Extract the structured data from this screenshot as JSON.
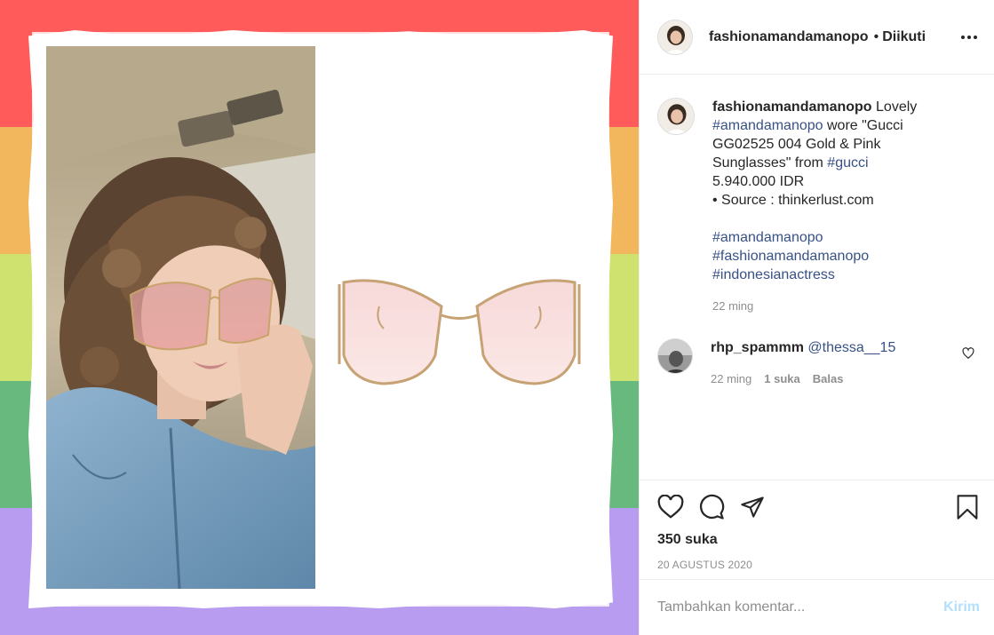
{
  "colors": {
    "stripes": [
      "#ff5b5b",
      "#f2b65c",
      "#cfe16e",
      "#67b97e",
      "#b79cf0"
    ],
    "link": "#385185",
    "secondary_text": "#8e8e8e",
    "post_button": "#b2dffc"
  },
  "header": {
    "username": "fashionamandamanopo",
    "separator": "•",
    "follow_label": "Diikuti",
    "more_icon": "more-options-icon"
  },
  "caption": {
    "username": "fashionamandamanopo",
    "text_1": " Lovely ",
    "hashtag_1": "#amandamanopo",
    "text_2": " wore \"Gucci GG02525 004 Gold & Pink Sunglasses\" from ",
    "hashtag_2": "#gucci",
    "price": "5.940.000 IDR",
    "source": "• Source : thinkerlust.com",
    "hashtags": [
      "#amandamanopo",
      "#fashionamandamanopo",
      "#indonesianactress"
    ],
    "time": "22 ming"
  },
  "comment": {
    "username": "rhp_spammm",
    "mention": "@thessa__15",
    "time": "22 ming",
    "likes": "1 suka",
    "reply_label": "Balas"
  },
  "actions": {
    "likes_count": "350 suka",
    "date": "20 AGUSTUS 2020"
  },
  "add_comment": {
    "placeholder": "Tambahkan komentar...",
    "post_label": "Kirim"
  }
}
